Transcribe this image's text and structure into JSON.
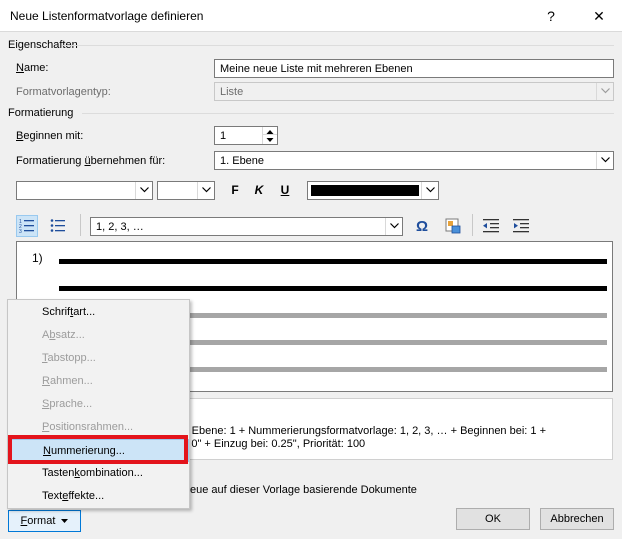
{
  "dialog": {
    "title": "Neue Listenformatvorlage definieren",
    "help_glyph": "?",
    "close_glyph": "✕"
  },
  "properties": {
    "section_label": "Eigenschaften",
    "name_label": "Name:",
    "name_value": "Meine neue Liste mit mehreren Ebenen",
    "type_label": "Formatvorlagentyp:",
    "type_value": "Liste"
  },
  "formatting": {
    "section_label": "Formatierung",
    "start_label": "Beginnen mit:",
    "start_value": "1",
    "apply_label": "Formatierung übernehmen für:",
    "apply_value": "1. Ebene",
    "font_value": "",
    "size_value": "",
    "bold": "F",
    "italic": "K",
    "underline": "U",
    "font_color": "#000000",
    "number_format_value": "1, 2, 3, …",
    "symbol_glyph": "Ω"
  },
  "preview": {
    "number": "1)",
    "dark_line_color": "#000000",
    "light_line_color": "#a6a6a6"
  },
  "description": {
    "line1": "g + Ebene: 1 + Nummerierungsformatvorlage: 1, 2, 3, … + Beginnen bei: 1 +",
    "line2": "an:  0\" + Einzug bei:  0.25\", Priorität: 100"
  },
  "new_documents_text": "eue auf dieser Vorlage basierende Dokumente",
  "buttons": {
    "format": "Format",
    "ok": "OK",
    "cancel": "Abbrechen"
  },
  "menu": {
    "items": [
      {
        "label": "Schriftart...",
        "enabled": true
      },
      {
        "label": "Absatz...",
        "enabled": false
      },
      {
        "label": "Tabstopp...",
        "enabled": false
      },
      {
        "label": "Rahmen...",
        "enabled": false
      },
      {
        "label": "Sprache...",
        "enabled": false
      },
      {
        "label": "Positionsrahmen...",
        "enabled": false
      },
      {
        "label": "Nummerierung...",
        "enabled": true
      },
      {
        "label": "Tastenkombination...",
        "enabled": true
      },
      {
        "label": "Texteffekte...",
        "enabled": true
      }
    ],
    "highlight_color": "#e3141c"
  }
}
